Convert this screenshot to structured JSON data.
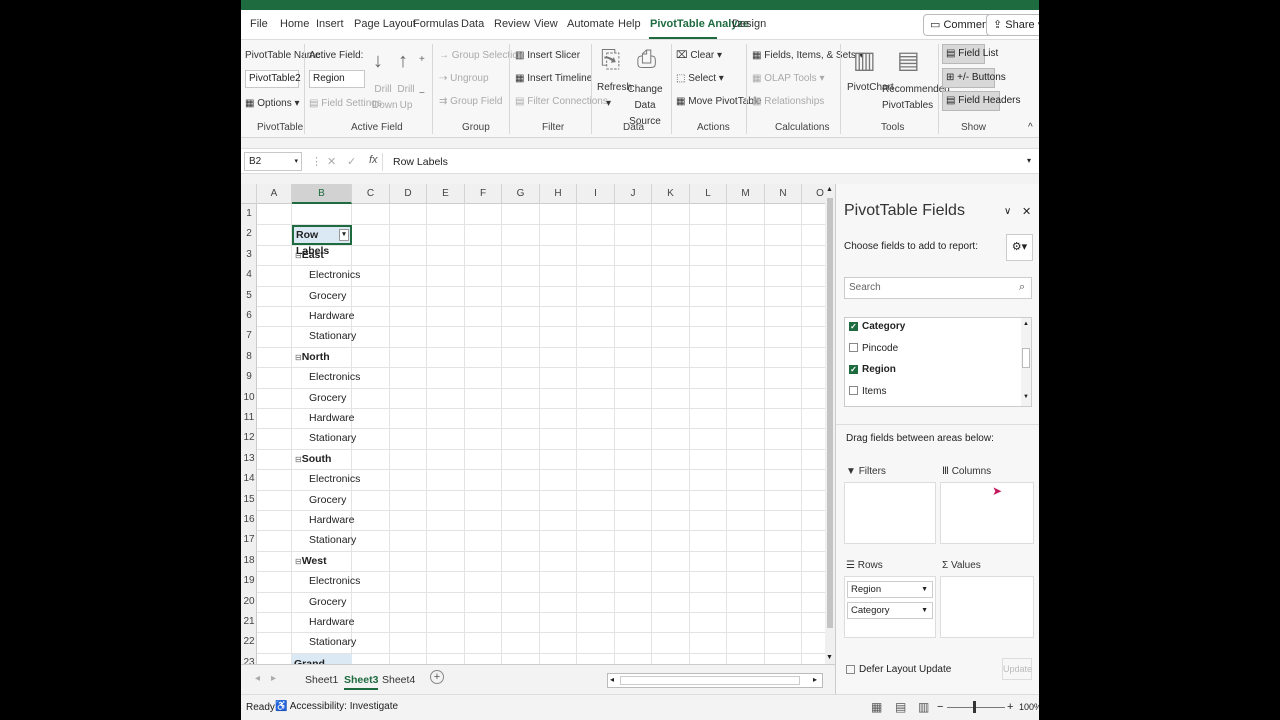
{
  "tabs": [
    "File",
    "Home",
    "Insert",
    "Page Layout",
    "Formulas",
    "Data",
    "Review",
    "View",
    "Automate",
    "Help",
    "PivotTable Analyze",
    "Design"
  ],
  "top_buttons": {
    "comments": "Comments",
    "share": "Share"
  },
  "ribbon": {
    "pivottable_name_label": "PivotTable Name:",
    "pivottable_name_value": "PivotTable2",
    "options": "Options",
    "active_field_label": "Active Field:",
    "active_field_value": "Region",
    "field_settings": "Field Settings",
    "drill_down": "Drill Down",
    "drill_up": "Drill Up",
    "group_selection": "Group Selection",
    "ungroup": "Ungroup",
    "group_field": "Group Field",
    "insert_slicer": "Insert Slicer",
    "insert_timeline": "Insert Timeline",
    "filter_connections": "Filter Connections",
    "refresh": "Refresh",
    "change_data_source": "Change Data Source",
    "clear": "Clear",
    "select": "Select",
    "move_pivottable": "Move PivotTable",
    "fields_items_sets": "Fields, Items, & Sets",
    "olap_tools": "OLAP Tools",
    "relationships": "Relationships",
    "pivotchart": "PivotChart",
    "recommended_pivottables": "Recommended PivotTables",
    "field_list": "Field List",
    "buttons": "+/- Buttons",
    "field_headers": "Field Headers",
    "groups": {
      "pivottable": "PivotTable",
      "active_field": "Active Field",
      "group": "Group",
      "filter": "Filter",
      "data": "Data",
      "actions": "Actions",
      "calculations": "Calculations",
      "tools": "Tools",
      "show": "Show"
    }
  },
  "formula_bar": {
    "name_box": "B2",
    "content": "Row Labels"
  },
  "columns": [
    "A",
    "B",
    "C",
    "D",
    "E",
    "F",
    "G",
    "H",
    "I",
    "J",
    "K",
    "L",
    "M",
    "N",
    "O"
  ],
  "rows": [
    "1",
    "2",
    "3",
    "4",
    "5",
    "6",
    "7",
    "8",
    "9",
    "10",
    "11",
    "12",
    "13",
    "14",
    "15",
    "16",
    "17",
    "18",
    "19",
    "20",
    "21",
    "22",
    "23"
  ],
  "pivot": {
    "header": "Row Labels",
    "groups": [
      {
        "name": "East",
        "items": [
          "Electronics",
          "Grocery",
          "Hardware",
          "Stationary"
        ]
      },
      {
        "name": "North",
        "items": [
          "Electronics",
          "Grocery",
          "Hardware",
          "Stationary"
        ]
      },
      {
        "name": "South",
        "items": [
          "Electronics",
          "Grocery",
          "Hardware",
          "Stationary"
        ]
      },
      {
        "name": "West",
        "items": [
          "Electronics",
          "Grocery",
          "Hardware",
          "Stationary"
        ]
      }
    ],
    "grand_total": "Grand Total"
  },
  "panel": {
    "title": "PivotTable Fields",
    "subtitle": "Choose fields to add to report:",
    "search_placeholder": "Search",
    "fields": [
      {
        "name": "Category",
        "checked": true
      },
      {
        "name": "Pincode",
        "checked": false
      },
      {
        "name": "Region",
        "checked": true
      },
      {
        "name": "Items",
        "checked": false
      }
    ],
    "drag_label": "Drag fields between areas below:",
    "filters": "Filters",
    "columns": "Columns",
    "rows": "Rows",
    "values": "Values",
    "row_fields": [
      "Region",
      "Category"
    ],
    "defer": "Defer Layout Update",
    "update": "Update"
  },
  "sheets": [
    {
      "name": "Sheet1",
      "active": false
    },
    {
      "name": "Sheet3",
      "active": true
    },
    {
      "name": "Sheet4",
      "active": false
    }
  ],
  "status": {
    "ready": "Ready",
    "accessibility": "Accessibility: Investigate",
    "zoom": "100%"
  }
}
